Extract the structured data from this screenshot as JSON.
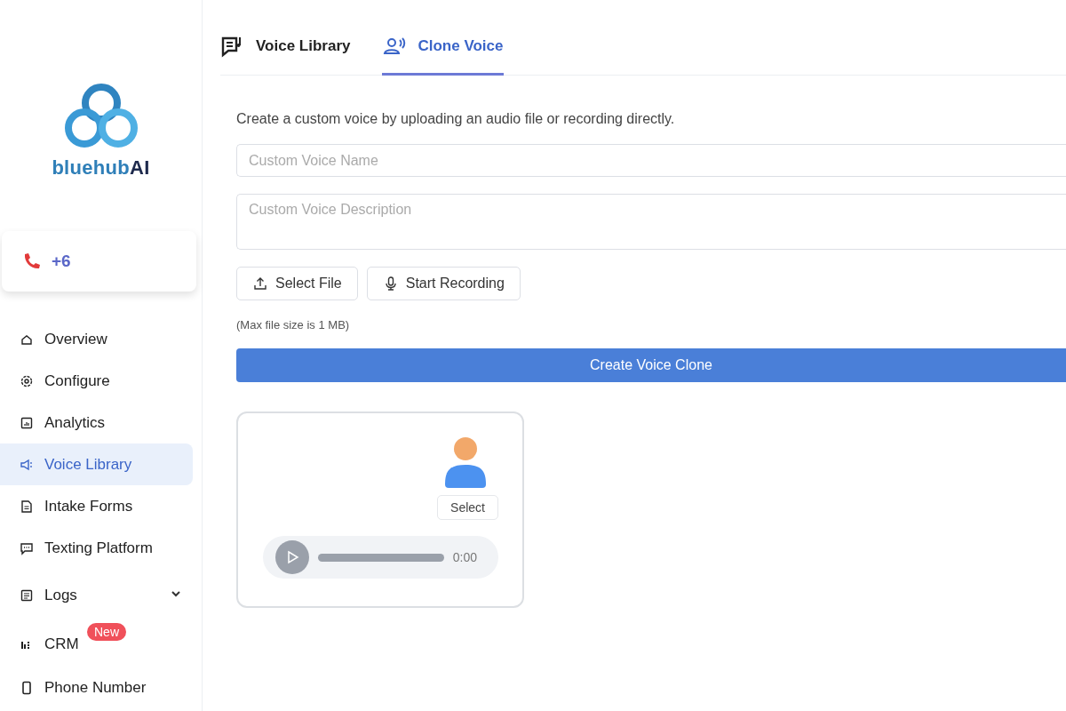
{
  "brand": {
    "name": "bluehub**AI**"
  },
  "phone_card": {
    "number": "+6"
  },
  "sidebar": {
    "items": [
      {
        "label": "Overview",
        "selected": false
      },
      {
        "label": "Configure",
        "selected": false
      },
      {
        "label": "Analytics",
        "selected": false
      },
      {
        "label": "Voice Library",
        "selected": true
      },
      {
        "label": "Intake Forms",
        "selected": false
      },
      {
        "label": "Texting Platform",
        "selected": false
      },
      {
        "label": "Logs",
        "selected": false,
        "expanded": false
      },
      {
        "label": "CRM",
        "selected": false,
        "badge": "New"
      },
      {
        "label": "Phone Number",
        "selected": false
      }
    ]
  },
  "tabs": [
    {
      "label": "Voice Library",
      "selected": false
    },
    {
      "label": "Clone Voice",
      "selected": true
    }
  ],
  "description": "Create a custom voice by uploading an audio file or recording directly.",
  "name_field": {
    "placeholder": "Custom Voice Name"
  },
  "description_field": {
    "placeholder": "Custom Voice Description"
  },
  "buttons": [
    {
      "label": "Select File"
    },
    {
      "label": "Start Recording"
    }
  ],
  "note": "(Max file size is 1 MB)",
  "submit": {
    "label": "Create Voice Clone"
  },
  "voice_card": {
    "select_label": "Select",
    "time": "0:00"
  }
}
